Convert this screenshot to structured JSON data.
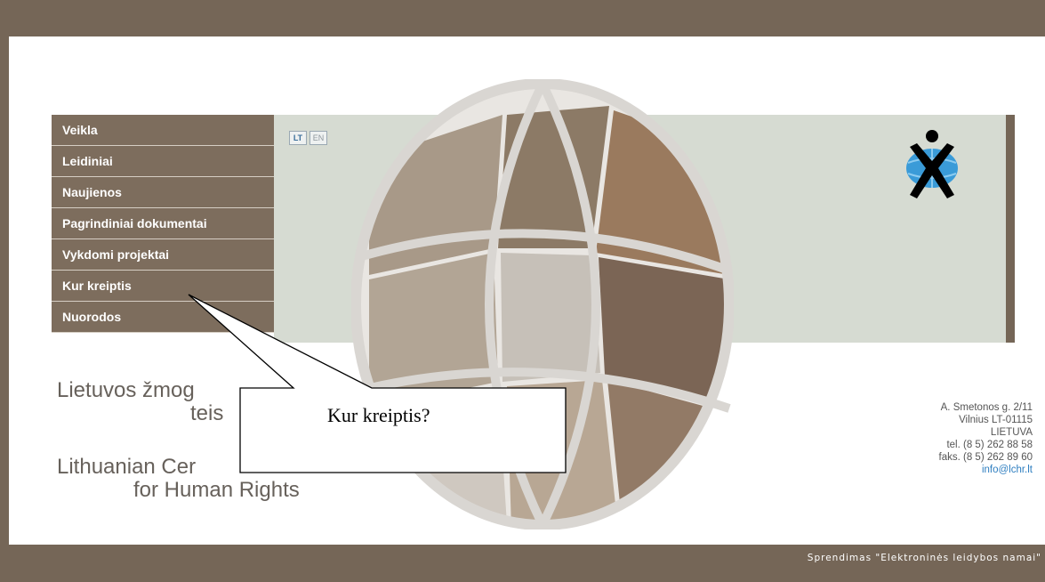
{
  "menu": {
    "items": [
      {
        "label": "Veikla"
      },
      {
        "label": "Leidiniai"
      },
      {
        "label": "Naujienos"
      },
      {
        "label": "Pagrindiniai dokumentai"
      },
      {
        "label": "Vykdomi projektai"
      },
      {
        "label": "Kur kreiptis"
      },
      {
        "label": "Nuorodos"
      }
    ]
  },
  "language": {
    "lt": "LT",
    "en": "EN",
    "active": "LT"
  },
  "organization": {
    "name_lt_line1": "Lietuvos žmog",
    "name_lt_line2": "teis",
    "name_en_line1": "Lithuanian Cer",
    "name_en_line2": "for Human Rights"
  },
  "contact": {
    "street": "A. Smetonos g. 2/11",
    "city": "Vilnius LT-01115",
    "country": "LIETUVA",
    "phone": "tel. (8 5) 262 88 58",
    "fax": "faks. (8 5) 262 89 60",
    "email": "info@lchr.lt"
  },
  "callout": {
    "text": "Kur kreiptis?"
  },
  "footer": {
    "credit": "Sprendimas \"Elektroninės leidybos namai\""
  },
  "colors": {
    "frame": "#756657",
    "menu_bg": "#7d6d5d",
    "banner_bg": "#d6dbd2",
    "link": "#2e7ec0"
  },
  "icons": {
    "logo": "human-figure-globe-logo",
    "globe": "globe-photo-collage"
  }
}
